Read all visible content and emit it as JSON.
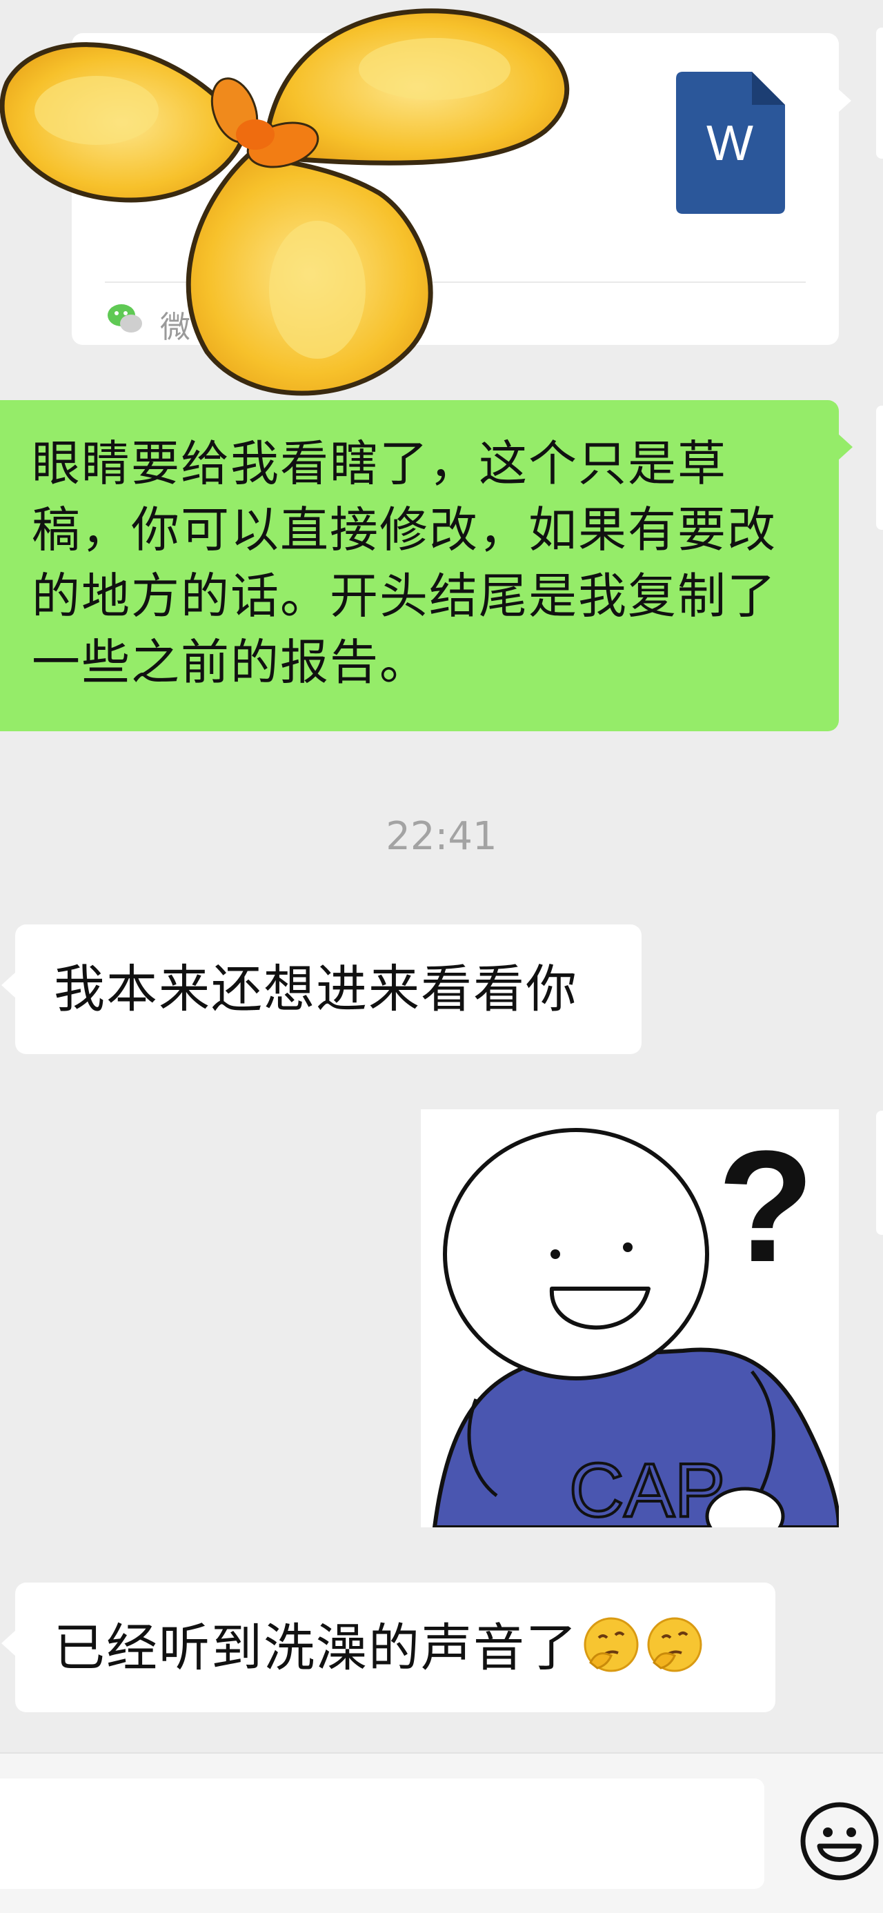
{
  "messages": {
    "file_card": {
      "source_label": "微",
      "file_type": "W",
      "file_icon": "word-document-icon",
      "source_icon": "wechat-icon"
    },
    "outgoing_text": "眼睛要给我看瞎了，这个只是草稿，你可以直接修改，如果有要改的地方的话。开头结尾是我复制了一些之前的报告。",
    "timestamp": "22:41",
    "incoming_1": "我本来还想进来看看你",
    "incoming_2": "已经听到洗澡的声音了",
    "sticker_text": "?",
    "sticker_shirt_text": "CAP",
    "emoji_name": "thinking-face-emoji"
  },
  "input_bar": {
    "emoji_button_icon": "smiley-icon"
  },
  "colors": {
    "background": "#ededed",
    "outgoing_bubble": "#95ec69",
    "incoming_bubble": "#ffffff",
    "word_blue": "#2b579a"
  }
}
